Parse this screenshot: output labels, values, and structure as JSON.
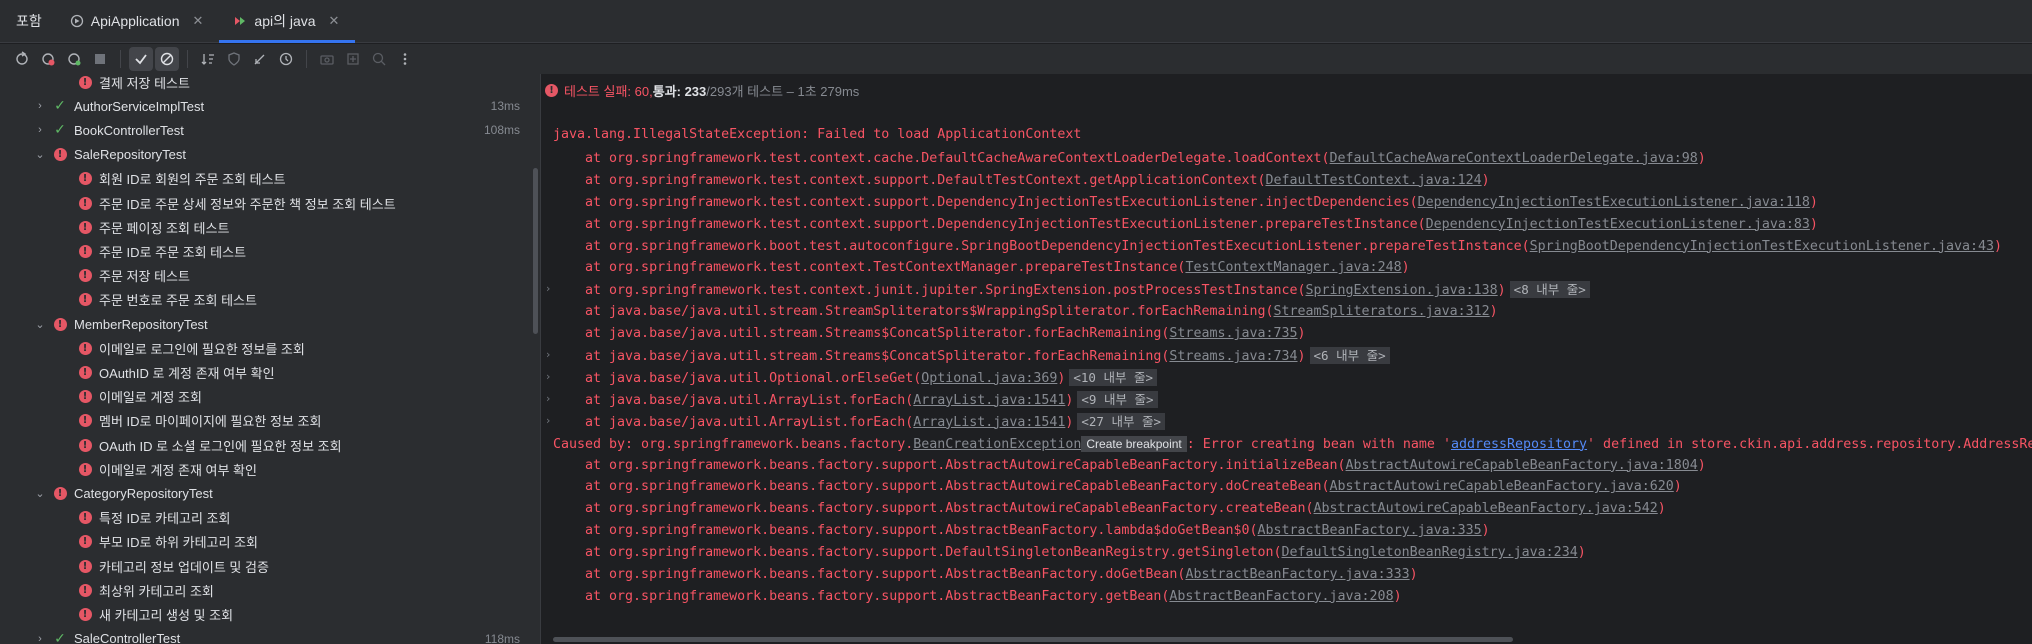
{
  "tabs": {
    "run_label": "포함",
    "items": [
      {
        "label": "ApiApplication",
        "icon": "spring-run-icon"
      },
      {
        "label": "api의 java",
        "icon": "test-run-icon"
      }
    ]
  },
  "tree": {
    "rows": [
      {
        "label": "결제 저장 테스트",
        "status": "fail",
        "indent": 2,
        "time": ""
      },
      {
        "label": "AuthorServiceImplTest",
        "status": "pass",
        "indent": 1,
        "chev": "›",
        "time": "13ms"
      },
      {
        "label": "BookControllerTest",
        "status": "pass",
        "indent": 1,
        "chev": "›",
        "time": "108ms"
      },
      {
        "label": "SaleRepositoryTest",
        "status": "fail",
        "indent": 1,
        "chev": "⌄",
        "time": ""
      },
      {
        "label": "회원 ID로 회원의 주문 조회 테스트",
        "status": "fail",
        "indent": 2,
        "time": ""
      },
      {
        "label": "주문 ID로 주문 상세 정보와 주문한 책 정보 조회 테스트",
        "status": "fail",
        "indent": 2,
        "time": ""
      },
      {
        "label": "주문 페이징 조회 테스트",
        "status": "fail",
        "indent": 2,
        "time": ""
      },
      {
        "label": "주문 ID로 주문 조회 테스트",
        "status": "fail",
        "indent": 2,
        "time": ""
      },
      {
        "label": "주문 저장 테스트",
        "status": "fail",
        "indent": 2,
        "time": ""
      },
      {
        "label": "주문 번호로 주문 조회 테스트",
        "status": "fail",
        "indent": 2,
        "time": ""
      },
      {
        "label": "MemberRepositoryTest",
        "status": "fail",
        "indent": 1,
        "chev": "⌄",
        "time": ""
      },
      {
        "label": "이메일로 로그인에 필요한 정보를 조회",
        "status": "fail",
        "indent": 2,
        "time": ""
      },
      {
        "label": "OAuthID 로 계정 존재 여부 확인",
        "status": "fail",
        "indent": 2,
        "time": ""
      },
      {
        "label": "이메일로 계정 조회",
        "status": "fail",
        "indent": 2,
        "time": ""
      },
      {
        "label": "멤버 ID로 마이페이지에 필요한 정보 조회",
        "status": "fail",
        "indent": 2,
        "time": ""
      },
      {
        "label": "OAuth ID 로 소셜 로그인에 필요한 정보 조회",
        "status": "fail",
        "indent": 2,
        "time": ""
      },
      {
        "label": "이메일로 계정 존재 여부 확인",
        "status": "fail",
        "indent": 2,
        "time": ""
      },
      {
        "label": "CategoryRepositoryTest",
        "status": "fail",
        "indent": 1,
        "chev": "⌄",
        "time": ""
      },
      {
        "label": "특정 ID로 카테고리 조회",
        "status": "fail",
        "indent": 2,
        "time": ""
      },
      {
        "label": "부모 ID로 하위 카테고리 조회",
        "status": "fail",
        "indent": 2,
        "time": ""
      },
      {
        "label": "카테고리 정보 업데이트 및 검증",
        "status": "fail",
        "indent": 2,
        "time": ""
      },
      {
        "label": "최상위 카테고리 조회",
        "status": "fail",
        "indent": 2,
        "time": ""
      },
      {
        "label": "새 카테고리 생성 및 조회",
        "status": "fail",
        "indent": 2,
        "time": ""
      },
      {
        "label": "SaleControllerTest",
        "status": "pass",
        "indent": 1,
        "chev": "›",
        "time": "118ms"
      }
    ]
  },
  "status": {
    "failed": "테스트 실패: 60,",
    "passed": " 통과: 233",
    "rest": " /293개 테스트 – 1초 279ms"
  },
  "console": {
    "lines": [
      {
        "pre": "java.lang.IllegalStateException: Failed to load ApplicationContext",
        "link": "",
        "post": "",
        "badge": "",
        "gutter": false
      },
      {
        "pre": "",
        "link": "",
        "post": "",
        "badge": "",
        "gutter": false
      },
      {
        "pre": "    at org.springframework.test.context.cache.DefaultCacheAwareContextLoaderDelegate.loadContext(",
        "link": "DefaultCacheAwareContextLoaderDelegate.java:98",
        "post": ")",
        "badge": "",
        "gutter": false
      },
      {
        "pre": "    at org.springframework.test.context.support.DefaultTestContext.getApplicationContext(",
        "link": "DefaultTestContext.java:124",
        "post": ")",
        "badge": "",
        "gutter": false
      },
      {
        "pre": "    at org.springframework.test.context.support.DependencyInjectionTestExecutionListener.injectDependencies(",
        "link": "DependencyInjectionTestExecutionListener.java:118",
        "post": ")",
        "badge": "",
        "gutter": false
      },
      {
        "pre": "    at org.springframework.test.context.support.DependencyInjectionTestExecutionListener.prepareTestInstance(",
        "link": "DependencyInjectionTestExecutionListener.java:83",
        "post": ")",
        "badge": "",
        "gutter": false
      },
      {
        "pre": "    at org.springframework.boot.test.autoconfigure.SpringBootDependencyInjectionTestExecutionListener.prepareTestInstance(",
        "link": "SpringBootDependencyInjectionTestExecutionListener.java:43",
        "post": ")",
        "badge": "",
        "gutter": false
      },
      {
        "pre": "    at org.springframework.test.context.TestContextManager.prepareTestInstance(",
        "link": "TestContextManager.java:248",
        "post": ")",
        "badge": "",
        "gutter": false
      },
      {
        "pre": "    at org.springframework.test.context.junit.jupiter.SpringExtension.postProcessTestInstance(",
        "link": "SpringExtension.java:138",
        "post": ")",
        "badge": "<8 내부 줄>",
        "gutter": true
      },
      {
        "pre": "    at java.base/java.util.stream.StreamSpliterators$WrappingSpliterator.forEachRemaining(",
        "link": "StreamSpliterators.java:312",
        "post": ")",
        "badge": "",
        "gutter": false
      },
      {
        "pre": "    at java.base/java.util.stream.Streams$ConcatSpliterator.forEachRemaining(",
        "link": "Streams.java:735",
        "post": ")",
        "badge": "",
        "gutter": false
      },
      {
        "pre": "    at java.base/java.util.stream.Streams$ConcatSpliterator.forEachRemaining(",
        "link": "Streams.java:734",
        "post": ")",
        "badge": "<6 내부 줄>",
        "gutter": true
      },
      {
        "pre": "    at java.base/java.util.Optional.orElseGet(",
        "link": "Optional.java:369",
        "post": ")",
        "badge": "<10 내부 줄>",
        "gutter": true
      },
      {
        "pre": "    at java.base/java.util.ArrayList.forEach(",
        "link": "ArrayList.java:1541",
        "post": ")",
        "badge": "<9 내부 줄>",
        "gutter": true
      },
      {
        "pre": "    at java.base/java.util.ArrayList.forEach(",
        "link": "ArrayList.java:1541",
        "post": ")",
        "badge": "<27 내부 줄>",
        "gutter": true
      },
      {
        "pre": "Caused by: org.springframework.beans.factory.",
        "link": "BeanCreationException",
        "tip": "Create breakpoint",
        "post": ": Error creating bean with name '",
        "blue": "addressRepository",
        "post2": "' defined in store.ckin.api.address.repository.AddressRepos",
        "badge": "",
        "gutter": false
      },
      {
        "pre": "    at org.springframework.beans.factory.support.AbstractAutowireCapableBeanFactory.initializeBean(",
        "link": "AbstractAutowireCapableBeanFactory.java:1804",
        "post": ")",
        "badge": "",
        "gutter": false
      },
      {
        "pre": "    at org.springframework.beans.factory.support.AbstractAutowireCapableBeanFactory.doCreateBean(",
        "link": "AbstractAutowireCapableBeanFactory.java:620",
        "post": ")",
        "badge": "",
        "gutter": false
      },
      {
        "pre": "    at org.springframework.beans.factory.support.AbstractAutowireCapableBeanFactory.createBean(",
        "link": "AbstractAutowireCapableBeanFactory.java:542",
        "post": ")",
        "badge": "",
        "gutter": false
      },
      {
        "pre": "    at org.springframework.beans.factory.support.AbstractBeanFactory.lambda$doGetBean$0(",
        "link": "AbstractBeanFactory.java:335",
        "post": ")",
        "badge": "",
        "gutter": false
      },
      {
        "pre": "    at org.springframework.beans.factory.support.DefaultSingletonBeanRegistry.getSingleton(",
        "link": "DefaultSingletonBeanRegistry.java:234",
        "post": ")",
        "badge": "",
        "gutter": false
      },
      {
        "pre": "    at org.springframework.beans.factory.support.AbstractBeanFactory.doGetBean(",
        "link": "AbstractBeanFactory.java:333",
        "post": ")",
        "badge": "",
        "gutter": false
      },
      {
        "pre": "    at org.springframework.beans.factory.support.AbstractBeanFactory.getBean(",
        "link": "AbstractBeanFactory.java:208",
        "post": ")",
        "badge": "",
        "gutter": false
      }
    ]
  },
  "colors": {
    "error": "#f75464",
    "pass": "#5fb865",
    "accent": "#3574f0",
    "link": "#868a91"
  }
}
